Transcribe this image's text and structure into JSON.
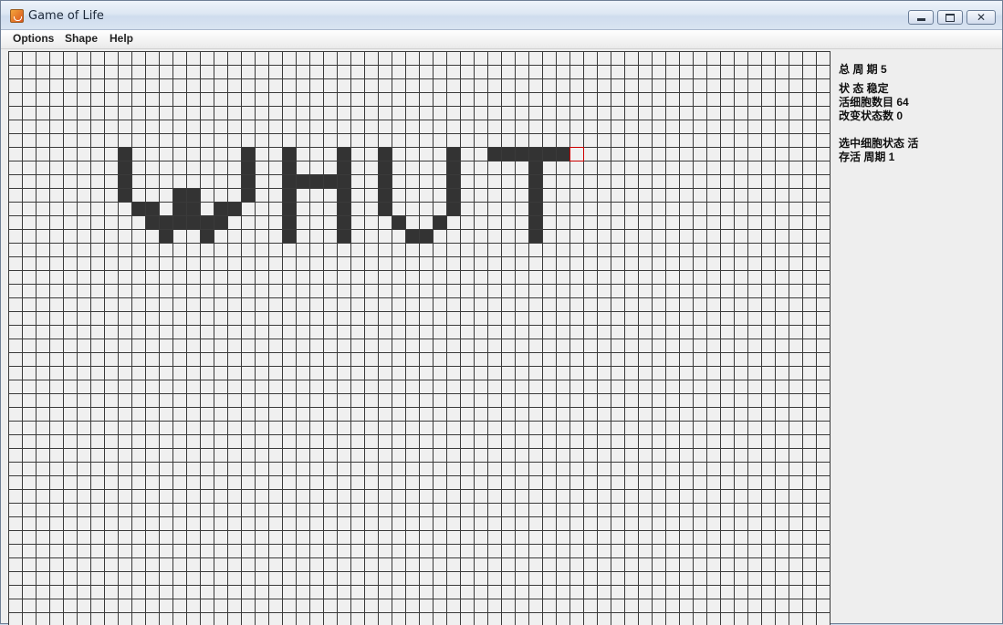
{
  "window": {
    "title": "Game of Life"
  },
  "menu": {
    "items": [
      "Options",
      "Shape",
      "Help"
    ]
  },
  "info": {
    "total_generations": "总 周 期 5",
    "state": "状 态 稳定",
    "live_cells": "活细胞数目 64",
    "changed_cells": "改变状态数 0",
    "selected_state": "选中细胞状态 活",
    "survive_period": "存活 周期 1"
  },
  "grid": {
    "cols": 60,
    "rows": 42,
    "live_color": "#333333",
    "dead_color": "#f0f0f0",
    "line_color": "#3a3a3a",
    "selected_color": "#cc0000",
    "selected_cell": [
      41,
      7
    ],
    "live_cells": [
      [
        8,
        7
      ],
      [
        8,
        8
      ],
      [
        8,
        9
      ],
      [
        8,
        10
      ],
      [
        9,
        11
      ],
      [
        10,
        11
      ],
      [
        10,
        12
      ],
      [
        11,
        12
      ],
      [
        11,
        13
      ],
      [
        12,
        12
      ],
      [
        12,
        11
      ],
      [
        12,
        10
      ],
      [
        13,
        10
      ],
      [
        13,
        11
      ],
      [
        13,
        12
      ],
      [
        14,
        12
      ],
      [
        14,
        13
      ],
      [
        15,
        11
      ],
      [
        15,
        12
      ],
      [
        16,
        11
      ],
      [
        17,
        10
      ],
      [
        17,
        9
      ],
      [
        17,
        8
      ],
      [
        17,
        7
      ],
      [
        20,
        7
      ],
      [
        20,
        8
      ],
      [
        20,
        9
      ],
      [
        20,
        10
      ],
      [
        20,
        11
      ],
      [
        20,
        12
      ],
      [
        20,
        13
      ],
      [
        21,
        9
      ],
      [
        22,
        9
      ],
      [
        23,
        9
      ],
      [
        24,
        9
      ],
      [
        24,
        7
      ],
      [
        24,
        8
      ],
      [
        24,
        10
      ],
      [
        24,
        11
      ],
      [
        24,
        12
      ],
      [
        24,
        13
      ],
      [
        27,
        7
      ],
      [
        27,
        8
      ],
      [
        27,
        9
      ],
      [
        27,
        10
      ],
      [
        27,
        11
      ],
      [
        28,
        12
      ],
      [
        29,
        13
      ],
      [
        30,
        13
      ],
      [
        31,
        12
      ],
      [
        32,
        11
      ],
      [
        32,
        10
      ],
      [
        32,
        9
      ],
      [
        32,
        8
      ],
      [
        32,
        7
      ],
      [
        35,
        7
      ],
      [
        36,
        7
      ],
      [
        37,
        7
      ],
      [
        38,
        7
      ],
      [
        39,
        7
      ],
      [
        40,
        7
      ],
      [
        38,
        8
      ],
      [
        38,
        9
      ],
      [
        38,
        10
      ],
      [
        38,
        11
      ],
      [
        38,
        12
      ],
      [
        38,
        13
      ]
    ]
  }
}
